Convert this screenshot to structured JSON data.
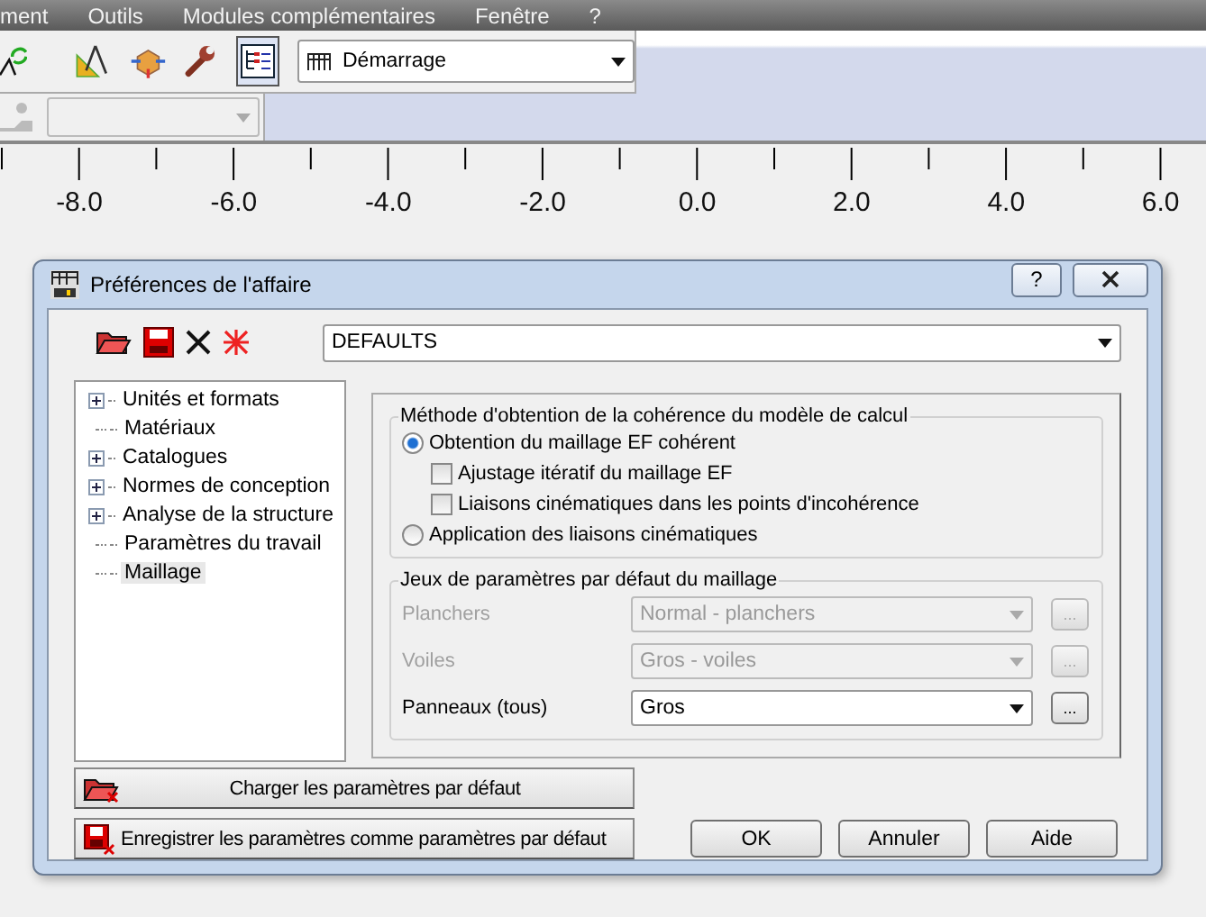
{
  "menu": [
    "ment",
    "Outils",
    "Modules complémentaires",
    "Fenêtre",
    "?"
  ],
  "toolbar": {
    "view_combo": "Démarrage",
    "tree_button_pressed": true
  },
  "ruler": [
    "-8.0",
    "-6.0",
    "-4.0",
    "-2.0",
    "0.0",
    "2.0",
    "4.0",
    "6.0"
  ],
  "dialog": {
    "title": "Préférences de l'affaire",
    "help": "?",
    "profile": "DEFAULTS",
    "tree": [
      {
        "label": "Unités et formats",
        "expandable": true,
        "selected": false
      },
      {
        "label": "Matériaux",
        "expandable": false,
        "selected": false
      },
      {
        "label": "Catalogues",
        "expandable": true,
        "selected": false
      },
      {
        "label": "Normes de conception",
        "expandable": true,
        "selected": false
      },
      {
        "label": "Analyse de la structure",
        "expandable": true,
        "selected": false
      },
      {
        "label": "Paramètres du travail",
        "expandable": false,
        "selected": false
      },
      {
        "label": "Maillage",
        "expandable": false,
        "selected": true
      }
    ],
    "method_group": {
      "title": "Méthode d'obtention de la cohérence du modèle de calcul",
      "options": [
        {
          "kind": "radio",
          "label": "Obtention du maillage EF cohérent",
          "selected": true,
          "children": [
            {
              "kind": "checkbox",
              "label": "Ajustage itératif du maillage EF",
              "checked": false
            },
            {
              "kind": "checkbox",
              "label": "Liaisons cinématiques dans les points d'incohérence",
              "checked": false
            }
          ]
        },
        {
          "kind": "radio",
          "label": "Application des liaisons cinématiques",
          "selected": false
        }
      ]
    },
    "mesh_group": {
      "title": "Jeux de paramètres par défaut du maillage",
      "rows": [
        {
          "label": "Planchers",
          "value": "Normal - planchers",
          "more": "...",
          "disabled": true
        },
        {
          "label": "Voiles",
          "value": "Gros - voiles",
          "more": "...",
          "disabled": true
        },
        {
          "label": "Panneaux (tous)",
          "value": "Gros",
          "more": "...",
          "disabled": false
        }
      ]
    },
    "load_button": "Charger les paramètres par défaut",
    "save_button": "Enregistrer les paramètres comme paramètres par défaut",
    "buttons": [
      "OK",
      "Annuler",
      "Aide"
    ]
  }
}
